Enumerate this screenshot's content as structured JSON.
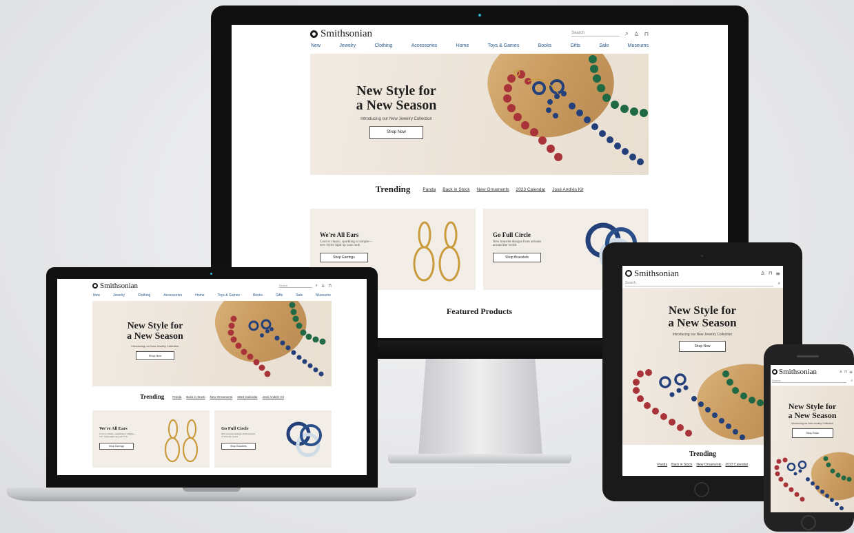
{
  "site": {
    "brand": "Smithsonian",
    "search_placeholder": "Search",
    "nav": [
      "New",
      "Jewelry",
      "Clothing",
      "Accessories",
      "Home",
      "Toys & Games",
      "Books",
      "Gifts",
      "Sale",
      "Museums"
    ]
  },
  "hero": {
    "title_line1": "New Style for",
    "title_line2": "a New Season",
    "subtitle": "Introducing our New Jewelry Collection",
    "cta": "Shop Now"
  },
  "trending": {
    "title": "Trending",
    "links": [
      "Panda",
      "Back in Stock",
      "New Ornaments",
      "2023 Calendar",
      "José Andrés Kit"
    ]
  },
  "promos": [
    {
      "title": "We're All Ears",
      "text_line1": "Cool or classic, sparkling or simple—",
      "text_line2": "new styles light up your look",
      "cta": "Shop Earrings"
    },
    {
      "title": "Go Full Circle",
      "text_line1": "New bracelet designs from artisans",
      "text_line2": "around the world",
      "cta": "Shop Bracelets"
    }
  ],
  "featured": {
    "title": "Featured Products"
  },
  "icons": {
    "search": "search-icon",
    "account": "user-icon",
    "bag": "shopping-bag-icon",
    "menu": "hamburger-menu-icon"
  },
  "colors": {
    "nav_link": "#2a5a8a",
    "hero_bg": "#ede5da",
    "bead_red": "#a8343a",
    "bead_blue": "#23407a",
    "bead_green": "#1f6a45",
    "gold": "#c99b3b"
  }
}
